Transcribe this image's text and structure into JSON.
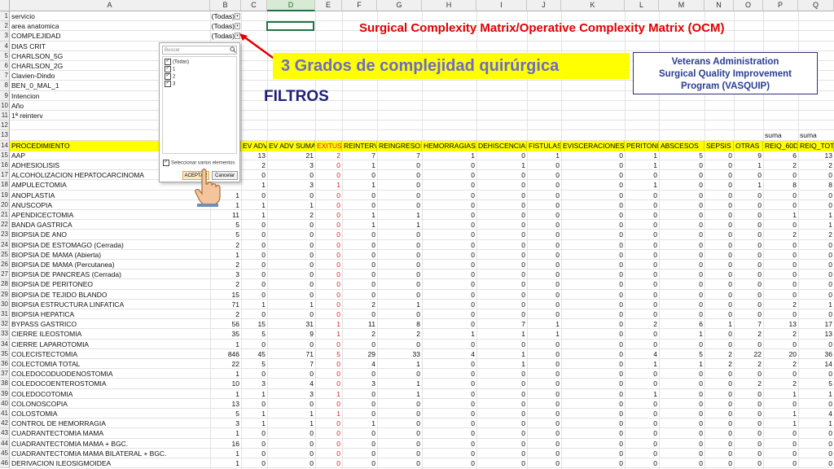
{
  "columns": [
    "A",
    "B",
    "C",
    "D",
    "E",
    "F",
    "G",
    "H",
    "I",
    "J",
    "K",
    "L",
    "M",
    "N",
    "O",
    "P",
    "Q"
  ],
  "filter_rows": [
    {
      "row": "1",
      "label": "servicio",
      "value": "(Todas)"
    },
    {
      "row": "2",
      "label": "area anatomica",
      "value": "(Todas)"
    },
    {
      "row": "3",
      "label": "COMPLEJIDAD",
      "value": "(Todas)"
    },
    {
      "row": "4",
      "label": "DIAS CRIT",
      "value": ""
    },
    {
      "row": "5",
      "label": "CHARLSON_5G",
      "value": ""
    },
    {
      "row": "6",
      "label": "CHARLSON_2G",
      "value": ""
    },
    {
      "row": "7",
      "label": "Clavien-Dindo",
      "value": ""
    },
    {
      "row": "8",
      "label": "BEN_0_MAL_1",
      "value": ""
    },
    {
      "row": "9",
      "label": "Intencion",
      "value": ""
    },
    {
      "row": "10",
      "label": "Año",
      "value": ""
    },
    {
      "row": "11",
      "label": "1ª reinterv",
      "value": ""
    },
    {
      "row": "12",
      "label": "",
      "value": ""
    },
    {
      "row": "13",
      "label": "",
      "value": ""
    }
  ],
  "suma_labels": [
    "suma",
    "suma"
  ],
  "table_header": {
    "row": "14",
    "cols": [
      "PROCEDIMIENTO",
      "EV ADV",
      "EV ADV SUMA",
      "EXITUS",
      "REINTERV",
      "REINGRESOS",
      "HEMORRAGIAS",
      "DEHISCENCIAS",
      "FISTULAS",
      "EVISCERACIONES",
      "PERITONITIS",
      "ABSCESOS",
      "SEPSIS",
      "OTRAS",
      "REIQ_60D",
      "REIQ_TOT"
    ]
  },
  "table_rows": [
    {
      "row": "15",
      "name": "AAP",
      "b": "",
      "c": "13",
      "d": "21",
      "e": "2",
      "f": "7",
      "g": "7",
      "h": "1",
      "i": "0",
      "j": "1",
      "k": "0",
      "l": "1",
      "m": "5",
      "n": "0",
      "o": "9",
      "p": "6",
      "q": "13"
    },
    {
      "row": "16",
      "name": "ADHESIOLISIS",
      "b": "",
      "c": "2",
      "d": "3",
      "e": "0",
      "f": "1",
      "g": "0",
      "h": "0",
      "i": "1",
      "j": "0",
      "k": "0",
      "l": "1",
      "m": "0",
      "n": "0",
      "o": "1",
      "p": "2",
      "q": "2"
    },
    {
      "row": "17",
      "name": "ALCOHOLIZACION HEPATOCARCINOMA",
      "b": "",
      "c": "0",
      "d": "0",
      "e": "0",
      "f": "0",
      "g": "0",
      "h": "0",
      "i": "0",
      "j": "0",
      "k": "0",
      "l": "0",
      "m": "0",
      "n": "0",
      "o": "0",
      "p": "0",
      "q": "0"
    },
    {
      "row": "18",
      "name": "AMPULECTOMIA",
      "b": "",
      "c": "1",
      "d": "3",
      "e": "1",
      "f": "1",
      "g": "0",
      "h": "0",
      "i": "0",
      "j": "0",
      "k": "0",
      "l": "1",
      "m": "0",
      "n": "0",
      "o": "1",
      "p": "8",
      "q": "8"
    },
    {
      "row": "19",
      "name": "ANOPLASTIA",
      "b": "1",
      "c": "0",
      "d": "0",
      "e": "0",
      "f": "0",
      "g": "0",
      "h": "0",
      "i": "0",
      "j": "0",
      "k": "0",
      "l": "0",
      "m": "0",
      "n": "0",
      "o": "0",
      "p": "0",
      "q": "0"
    },
    {
      "row": "20",
      "name": "ANUSCOPIA",
      "b": "1",
      "c": "1",
      "d": "1",
      "e": "0",
      "f": "0",
      "g": "0",
      "h": "0",
      "i": "0",
      "j": "0",
      "k": "0",
      "l": "0",
      "m": "0",
      "n": "0",
      "o": "0",
      "p": "0",
      "q": "0"
    },
    {
      "row": "21",
      "name": "APENDICECTOMIA",
      "b": "11",
      "c": "1",
      "d": "2",
      "e": "0",
      "f": "1",
      "g": "1",
      "h": "0",
      "i": "0",
      "j": "0",
      "k": "0",
      "l": "0",
      "m": "0",
      "n": "0",
      "o": "0",
      "p": "1",
      "q": "1"
    },
    {
      "row": "22",
      "name": "BANDA GASTRICA",
      "b": "5",
      "c": "0",
      "d": "0",
      "e": "0",
      "f": "1",
      "g": "1",
      "h": "0",
      "i": "0",
      "j": "0",
      "k": "0",
      "l": "0",
      "m": "0",
      "n": "0",
      "o": "0",
      "p": "0",
      "q": "1"
    },
    {
      "row": "23",
      "name": "BIOPSIA DE ANO",
      "b": "5",
      "c": "0",
      "d": "0",
      "e": "0",
      "f": "0",
      "g": "0",
      "h": "0",
      "i": "0",
      "j": "0",
      "k": "0",
      "l": "0",
      "m": "0",
      "n": "0",
      "o": "0",
      "p": "2",
      "q": "2"
    },
    {
      "row": "24",
      "name": "BIOPSIA DE ESTOMAGO (Cerrada)",
      "b": "2",
      "c": "0",
      "d": "0",
      "e": "0",
      "f": "0",
      "g": "0",
      "h": "0",
      "i": "0",
      "j": "0",
      "k": "0",
      "l": "0",
      "m": "0",
      "n": "0",
      "o": "0",
      "p": "0",
      "q": "0"
    },
    {
      "row": "25",
      "name": "BIOPSIA DE MAMA (Abierta)",
      "b": "1",
      "c": "0",
      "d": "0",
      "e": "0",
      "f": "0",
      "g": "0",
      "h": "0",
      "i": "0",
      "j": "0",
      "k": "0",
      "l": "0",
      "m": "0",
      "n": "0",
      "o": "0",
      "p": "0",
      "q": "0"
    },
    {
      "row": "26",
      "name": "BIOPSIA DE MAMA (Percutanea)",
      "b": "2",
      "c": "0",
      "d": "0",
      "e": "0",
      "f": "0",
      "g": "0",
      "h": "0",
      "i": "0",
      "j": "0",
      "k": "0",
      "l": "0",
      "m": "0",
      "n": "0",
      "o": "0",
      "p": "0",
      "q": "0"
    },
    {
      "row": "27",
      "name": "BIOPSIA DE PANCREAS (Cerrada)",
      "b": "3",
      "c": "0",
      "d": "0",
      "e": "0",
      "f": "0",
      "g": "0",
      "h": "0",
      "i": "0",
      "j": "0",
      "k": "0",
      "l": "0",
      "m": "0",
      "n": "0",
      "o": "0",
      "p": "0",
      "q": "0"
    },
    {
      "row": "28",
      "name": "BIOPSIA DE PERITONEO",
      "b": "2",
      "c": "0",
      "d": "0",
      "e": "0",
      "f": "0",
      "g": "0",
      "h": "0",
      "i": "0",
      "j": "0",
      "k": "0",
      "l": "0",
      "m": "0",
      "n": "0",
      "o": "0",
      "p": "0",
      "q": "0"
    },
    {
      "row": "29",
      "name": "BIOPSIA DE TEJIDO BLANDO",
      "b": "15",
      "c": "0",
      "d": "0",
      "e": "0",
      "f": "0",
      "g": "0",
      "h": "0",
      "i": "0",
      "j": "0",
      "k": "0",
      "l": "0",
      "m": "0",
      "n": "0",
      "o": "0",
      "p": "0",
      "q": "0"
    },
    {
      "row": "30",
      "name": "BIOPSIA ESTRUCTURA LINFATICA",
      "b": "71",
      "c": "1",
      "d": "1",
      "e": "0",
      "f": "2",
      "g": "1",
      "h": "0",
      "i": "0",
      "j": "0",
      "k": "0",
      "l": "0",
      "m": "0",
      "n": "0",
      "o": "0",
      "p": "2",
      "q": "1"
    },
    {
      "row": "31",
      "name": "BIOPSIA HEPATICA",
      "b": "2",
      "c": "0",
      "d": "0",
      "e": "0",
      "f": "0",
      "g": "0",
      "h": "0",
      "i": "0",
      "j": "0",
      "k": "0",
      "l": "0",
      "m": "0",
      "n": "0",
      "o": "0",
      "p": "0",
      "q": "0"
    },
    {
      "row": "32",
      "name": "BYPASS GASTRICO",
      "b": "56",
      "c": "15",
      "d": "31",
      "e": "1",
      "f": "11",
      "g": "8",
      "h": "0",
      "i": "7",
      "j": "1",
      "k": "0",
      "l": "2",
      "m": "6",
      "n": "1",
      "o": "7",
      "p": "13",
      "q": "17"
    },
    {
      "row": "33",
      "name": "CIERRE ILEOSTOMIA",
      "b": "35",
      "c": "5",
      "d": "9",
      "e": "1",
      "f": "2",
      "g": "2",
      "h": "1",
      "i": "1",
      "j": "1",
      "k": "0",
      "l": "0",
      "m": "1",
      "n": "0",
      "o": "2",
      "p": "2",
      "q": "13"
    },
    {
      "row": "34",
      "name": "CIERRE LAPAROTOMIA",
      "b": "1",
      "c": "0",
      "d": "0",
      "e": "0",
      "f": "0",
      "g": "0",
      "h": "0",
      "i": "0",
      "j": "0",
      "k": "0",
      "l": "0",
      "m": "0",
      "n": "0",
      "o": "0",
      "p": "0",
      "q": "0"
    },
    {
      "row": "35",
      "name": "COLECISTECTOMIA",
      "b": "846",
      "c": "45",
      "d": "71",
      "e": "5",
      "f": "29",
      "g": "33",
      "h": "4",
      "i": "1",
      "j": "0",
      "k": "0",
      "l": "4",
      "m": "5",
      "n": "2",
      "o": "22",
      "p": "20",
      "q": "36"
    },
    {
      "row": "36",
      "name": "COLECTOMIA TOTAL",
      "b": "22",
      "c": "5",
      "d": "7",
      "e": "0",
      "f": "4",
      "g": "1",
      "h": "0",
      "i": "1",
      "j": "0",
      "k": "0",
      "l": "1",
      "m": "1",
      "n": "2",
      "o": "2",
      "p": "2",
      "q": "14"
    },
    {
      "row": "37",
      "name": "COLEDOCODUODENOSTOMIA",
      "b": "1",
      "c": "0",
      "d": "0",
      "e": "0",
      "f": "0",
      "g": "0",
      "h": "0",
      "i": "0",
      "j": "0",
      "k": "0",
      "l": "0",
      "m": "0",
      "n": "0",
      "o": "0",
      "p": "0",
      "q": "0"
    },
    {
      "row": "38",
      "name": "COLEDOCOENTEROSTOMIA",
      "b": "10",
      "c": "3",
      "d": "4",
      "e": "0",
      "f": "3",
      "g": "1",
      "h": "0",
      "i": "0",
      "j": "0",
      "k": "0",
      "l": "0",
      "m": "0",
      "n": "0",
      "o": "2",
      "p": "2",
      "q": "5"
    },
    {
      "row": "39",
      "name": "COLEDOCOTOMIA",
      "b": "1",
      "c": "1",
      "d": "3",
      "e": "1",
      "f": "0",
      "g": "1",
      "h": "0",
      "i": "0",
      "j": "0",
      "k": "0",
      "l": "1",
      "m": "0",
      "n": "0",
      "o": "0",
      "p": "1",
      "q": "1"
    },
    {
      "row": "40",
      "name": "COLONOSCOPIA",
      "b": "13",
      "c": "0",
      "d": "0",
      "e": "0",
      "f": "0",
      "g": "0",
      "h": "0",
      "i": "0",
      "j": "0",
      "k": "0",
      "l": "0",
      "m": "0",
      "n": "0",
      "o": "0",
      "p": "0",
      "q": "0"
    },
    {
      "row": "41",
      "name": "COLOSTOMIA",
      "b": "5",
      "c": "1",
      "d": "1",
      "e": "1",
      "f": "0",
      "g": "0",
      "h": "0",
      "i": "0",
      "j": "0",
      "k": "0",
      "l": "0",
      "m": "0",
      "n": "0",
      "o": "0",
      "p": "1",
      "q": "4"
    },
    {
      "row": "42",
      "name": "CONTROL DE HEMORRAGIA",
      "b": "3",
      "c": "1",
      "d": "1",
      "e": "0",
      "f": "1",
      "g": "0",
      "h": "0",
      "i": "0",
      "j": "0",
      "k": "0",
      "l": "0",
      "m": "0",
      "n": "0",
      "o": "0",
      "p": "1",
      "q": "1"
    },
    {
      "row": "43",
      "name": "CUADRANTECTOMIA MAMA",
      "b": "1",
      "c": "0",
      "d": "0",
      "e": "0",
      "f": "0",
      "g": "0",
      "h": "0",
      "i": "0",
      "j": "0",
      "k": "0",
      "l": "0",
      "m": "0",
      "n": "0",
      "o": "0",
      "p": "0",
      "q": "0"
    },
    {
      "row": "44",
      "name": "CUADRANTECTOMIA MAMA + BGC.",
      "b": "16",
      "c": "0",
      "d": "0",
      "e": "0",
      "f": "0",
      "g": "0",
      "h": "0",
      "i": "0",
      "j": "0",
      "k": "0",
      "l": "0",
      "m": "0",
      "n": "0",
      "o": "0",
      "p": "0",
      "q": "0"
    },
    {
      "row": "45",
      "name": "CUADRANTECTOMIA MAMA BILATERAL + BGC.",
      "b": "1",
      "c": "0",
      "d": "0",
      "e": "0",
      "f": "0",
      "g": "0",
      "h": "0",
      "i": "0",
      "j": "0",
      "k": "0",
      "l": "0",
      "m": "0",
      "n": "0",
      "o": "0",
      "p": "0",
      "q": "0"
    },
    {
      "row": "46",
      "name": "DERIVACION ILEOSIGMOIDEA",
      "b": "1",
      "c": "0",
      "d": "0",
      "e": "0",
      "f": "0",
      "g": "0",
      "h": "0",
      "i": "0",
      "j": "0",
      "k": "0",
      "l": "0",
      "m": "0",
      "n": "0",
      "o": "0",
      "p": "0",
      "q": "0"
    }
  ],
  "overlay": {
    "title": "Surgical Complexity Matrix/Operative Complexity Matrix (OCM)",
    "subtitle": "3 Grados de complejidad quirúrgica",
    "filtros": "FILTROS",
    "va_box": [
      "Veterans Administration",
      "Surgical Quality Improvement",
      "Program (VASQUIP)"
    ]
  },
  "filter_panel": {
    "search_placeholder": "Buscar",
    "search_icon": "magnifier-icon",
    "items": [
      "(Todas)",
      "1",
      "2",
      "3"
    ],
    "multi_label": "Seleccionar varios elementos",
    "ok_label": "ACEPTAR",
    "cancel_label": "Cancelar"
  },
  "colors": {
    "header_fill": "#ffff00",
    "title_red": "#e00000",
    "subtitle_blue": "#6b6bcf",
    "filtros_navy": "#1f1f7a",
    "va_blue": "#2b3e92",
    "exitus_red": "#e02020"
  }
}
